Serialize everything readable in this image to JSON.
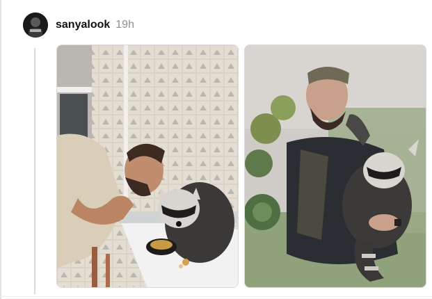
{
  "post": {
    "username": "sanyalook",
    "timestamp": "19h",
    "avatar_icon": "user-avatar"
  },
  "media": [
    {
      "icon": "photo-man-feeding-raccoon-kitchen"
    },
    {
      "icon": "photo-man-hugging-raccoon"
    }
  ],
  "colors": {
    "username": "#101010",
    "timestamp": "#8e8e8e",
    "thread_line": "#d9d9d9"
  }
}
